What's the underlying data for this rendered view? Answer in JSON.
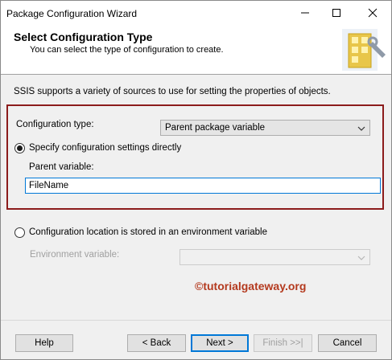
{
  "window": {
    "title": "Package Configuration Wizard"
  },
  "header": {
    "title": "Select Configuration Type",
    "subtitle": "You can select the type of configuration to create."
  },
  "intro_text": "SSIS supports a variety of sources to use for setting the properties of objects.",
  "config_type": {
    "label": "Configuration type:",
    "value": "Parent package variable"
  },
  "option_direct": {
    "label": "Specify configuration settings directly",
    "checked": true
  },
  "parent_variable": {
    "label": "Parent variable:",
    "value": "FileName"
  },
  "option_env": {
    "label": "Configuration location is stored in an environment variable",
    "checked": false
  },
  "env_variable": {
    "label": "Environment variable:",
    "value": ""
  },
  "watermark": "©tutorialgateway.org",
  "buttons": {
    "help": "Help",
    "back": "< Back",
    "next": "Next >",
    "finish": "Finish >>|",
    "cancel": "Cancel"
  },
  "colors": {
    "highlight_border": "#8c1c1c",
    "watermark": "#b43a1f",
    "focus": "#0078d7"
  }
}
